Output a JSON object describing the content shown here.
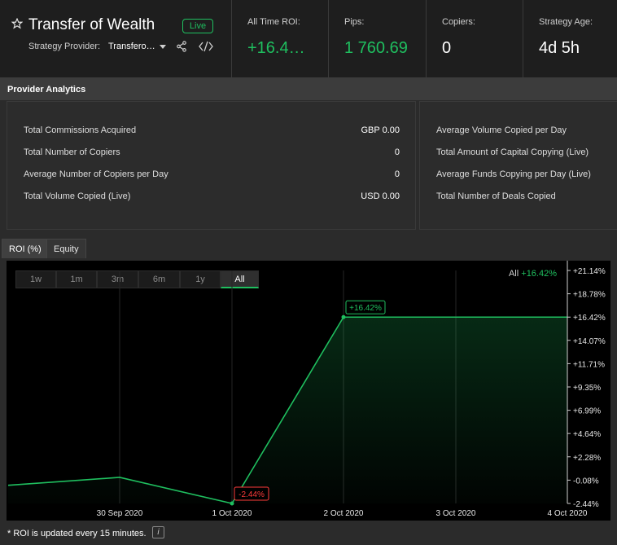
{
  "header": {
    "title": "Transfer of Wealth",
    "status_badge": "Live",
    "provider_label": "Strategy Provider:",
    "provider_value": "Transfero…",
    "metrics": [
      {
        "label": "All Time ROI:",
        "value": "+16.4…"
      },
      {
        "label": "Pips:",
        "value": "1 760.69"
      },
      {
        "label": "Copiers:",
        "value": "0"
      },
      {
        "label": "Strategy Age:",
        "value": "4d 5h"
      }
    ]
  },
  "analytics": {
    "title": "Provider Analytics",
    "left": [
      {
        "label": "Total Commissions Acquired",
        "value": "GBP 0.00"
      },
      {
        "label": "Total Number of Copiers",
        "value": "0"
      },
      {
        "label": "Average Number of Copiers per Day",
        "value": "0"
      },
      {
        "label": "Total Volume Copied (Live)",
        "value": "USD 0.00"
      }
    ],
    "right": [
      {
        "label": "Average Volume Copied per Day"
      },
      {
        "label": "Total Amount of Capital Copying (Live)"
      },
      {
        "label": "Average Funds Copying per Day (Live)"
      },
      {
        "label": "Total Number of Deals Copied"
      }
    ]
  },
  "tabs": [
    "ROI (%)",
    "Equity"
  ],
  "ranges": [
    "1w",
    "1m",
    "3m",
    "6m",
    "1y",
    "All"
  ],
  "summary": {
    "label": "All",
    "value": "+16.42%"
  },
  "chart_data": {
    "type": "area",
    "x_ticks": [
      "30 Sep 2020",
      "1 Oct 2020",
      "2 Oct 2020",
      "3 Oct 2020",
      "4 Oct 2020"
    ],
    "y_ticks": [
      "+21.14%",
      "+18.78%",
      "+16.42%",
      "+14.07%",
      "+11.71%",
      "+9.35%",
      "+6.99%",
      "+4.64%",
      "+2.28%",
      "-0.08%",
      "-2.44%"
    ],
    "ylim": [
      -2.44,
      21.14
    ],
    "points": [
      {
        "x": "29 Sep 2020",
        "y": -0.6
      },
      {
        "x": "30 Sep 2020",
        "y": 0.2
      },
      {
        "x": "1 Oct 2020",
        "y": -2.44
      },
      {
        "x": "2 Oct 2020",
        "y": 16.42
      },
      {
        "x": "4 Oct 2020",
        "y": 16.42
      }
    ],
    "annotations": [
      {
        "text": "-2.44%",
        "x": "1 Oct 2020",
        "y": -2.44,
        "color": "#ff3b3b"
      },
      {
        "text": "+16.42%",
        "x": "2 Oct 2020",
        "y": 16.42,
        "color": "#1fbf5f"
      }
    ],
    "line_color": "#1fbf5f",
    "grid": true
  },
  "footnote": "* ROI is updated every 15 minutes."
}
